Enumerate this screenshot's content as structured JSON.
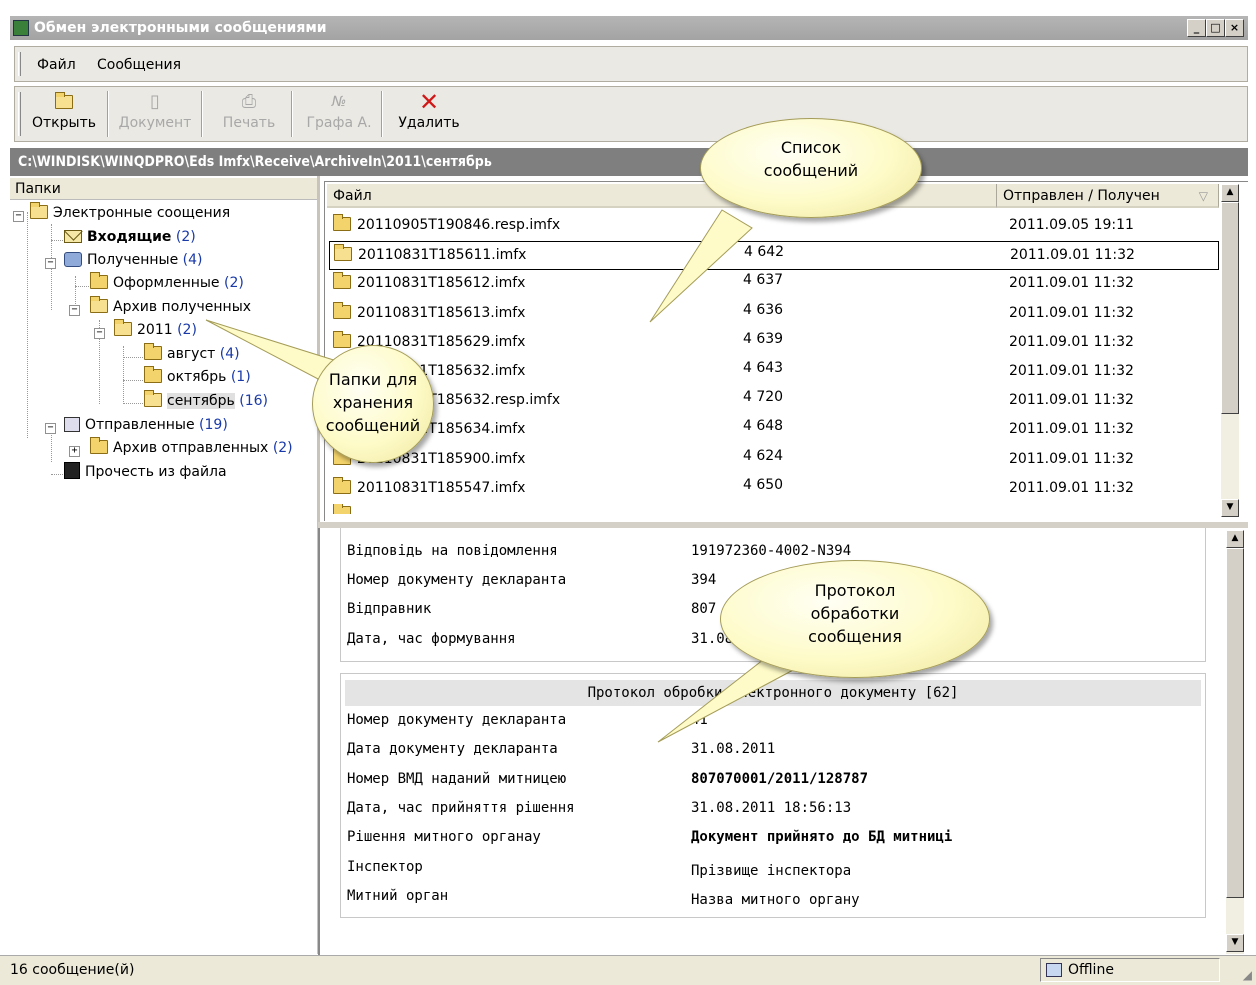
{
  "window": {
    "title": "Обмен электронными сообщениями",
    "buttons": [
      "_",
      "□",
      "×"
    ]
  },
  "menu": {
    "items": [
      "Файл",
      "Сообщения"
    ]
  },
  "toolbar": {
    "open": "Открыть",
    "document": "Документ",
    "print": "Печать",
    "grafa_icon": "№",
    "grafa": "Графа А.",
    "delete": "Удалить"
  },
  "path": "C:\\WINDISK\\WINQDPRO\\Eds Imfx\\Receive\\ArchiveIn\\2011\\сентябрь",
  "folders": {
    "header": "Папки",
    "root": "Электронные соощения",
    "inbox": {
      "label": "Входящие",
      "count": "(2)"
    },
    "received": {
      "label": "Полученные",
      "count": "(4)"
    },
    "processed": {
      "label": "Оформленные",
      "count": "(2)"
    },
    "archive_received": {
      "label": "Архив полученных"
    },
    "year": {
      "label": "2011",
      "count": "(2)"
    },
    "aug": {
      "label": "август",
      "count": "(4)"
    },
    "oct": {
      "label": "октябрь",
      "count": "(1)"
    },
    "sep": {
      "label": "сентябрь",
      "count": "(16)"
    },
    "sent": {
      "label": "Отправленные",
      "count": "(19)"
    },
    "archive_sent": {
      "label": "Архив отправленных",
      "count": "(2)"
    },
    "read_file": {
      "label": "Прочесть из файла"
    }
  },
  "list": {
    "columns": [
      "Файл",
      "Отправлен / Получен"
    ],
    "rows": [
      {
        "file": "20110905T190846.resp.imfx",
        "size": "",
        "date": "2011.09.05 19:11"
      },
      {
        "file": "20110831T185611.imfx",
        "size": "4 642",
        "date": "2011.09.01 11:32"
      },
      {
        "file": "20110831T185612.imfx",
        "size": "4 637",
        "date": "2011.09.01 11:32"
      },
      {
        "file": "20110831T185613.imfx",
        "size": "4 636",
        "date": "2011.09.01 11:32"
      },
      {
        "file": "20110831T185629.imfx",
        "size": "4 639",
        "date": "2011.09.01 11:32"
      },
      {
        "file": "20110831T185632.imfx",
        "size": "4 643",
        "date": "2011.09.01 11:32"
      },
      {
        "file": "20110831T185632.resp.imfx",
        "size": "4 720",
        "date": "2011.09.01 11:32"
      },
      {
        "file": "20110831T185634.imfx",
        "size": "4 648",
        "date": "2011.09.01 11:32"
      },
      {
        "file": "20110831T185900.imfx",
        "size": "4 624",
        "date": "2011.09.01 11:32"
      },
      {
        "file": "20110831T185547.imfx",
        "size": "4 650",
        "date": "2011.09.01 11:32"
      }
    ]
  },
  "protocol": {
    "header_rows": [
      {
        "label": "Відповідь на повідомлення",
        "value": "191972360-4002-N394"
      },
      {
        "label": "Номер документу декларанта",
        "value": "394"
      },
      {
        "label": "Відправник",
        "value": "807 обласної митниці"
      },
      {
        "label": "Дата, час формування",
        "value": "31.08"
      }
    ],
    "title": "Протокол обробки електронного документу [62]",
    "rows": [
      {
        "label": "Номер документу декларанта",
        "value": "41"
      },
      {
        "label": "Дата документу декларанта",
        "value": "31.08.2011"
      },
      {
        "label": "Номер ВМД наданий митницею",
        "value": "807070001/2011/128787"
      },
      {
        "label": "Дата, час прийняття рішення",
        "value": "31.08.2011 18:56:13"
      },
      {
        "label": "Рішення митного органау",
        "value": "Документ прийнято до БД митниці"
      },
      {
        "label": "Інспектор",
        "value": "Прізвище інспектора"
      },
      {
        "label": "Митний орган",
        "value": "Назва митного органу"
      }
    ]
  },
  "callouts": {
    "list": [
      "Список",
      "сообщений"
    ],
    "folders": [
      "Папки для",
      "хранения",
      "сообщений"
    ],
    "protocol": [
      "Протокол",
      "обработки",
      "сообщения"
    ]
  },
  "status": {
    "count": "16 сообщение(й)",
    "mode": "Offline"
  },
  "colors": {
    "titlebar": "#a9a9a9",
    "pathbar": "#7f7f7f",
    "callout": "#fefbc8",
    "count": "#1a3aa8"
  }
}
